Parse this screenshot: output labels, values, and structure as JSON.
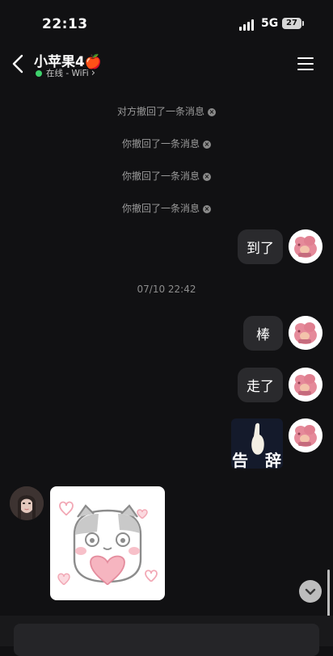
{
  "status_bar": {
    "time": "22:13",
    "network": "5G",
    "battery": "27"
  },
  "header": {
    "title": "小苹果4🍎",
    "presence": "在线 - WiFi",
    "presence_chevron": "›"
  },
  "notices": [
    {
      "text": "对方撤回了一条消息",
      "dismiss": "×"
    },
    {
      "text": "你撤回了一条消息",
      "dismiss": "×"
    },
    {
      "text": "你撤回了一条消息",
      "dismiss": "×"
    },
    {
      "text": "你撤回了一条消息",
      "dismiss": "×"
    }
  ],
  "messages": [
    {
      "from": "me",
      "text": "到了"
    },
    {
      "timestamp": "07/10 22:42"
    },
    {
      "from": "me",
      "text": "棒"
    },
    {
      "from": "me",
      "text": "走了"
    },
    {
      "from": "me",
      "sticker": "告辞",
      "sticker_left": "告",
      "sticker_right": "辞"
    },
    {
      "from": "other",
      "sticker": "cat-heart-sticker"
    }
  ],
  "icons": {
    "back": "back-chevron-icon",
    "menu": "hamburger-menu-icon",
    "scroll": "scroll-down-icon"
  },
  "colors": {
    "online": "#3ed16c",
    "bubble": "#2a2a2d",
    "background": "#111113"
  }
}
